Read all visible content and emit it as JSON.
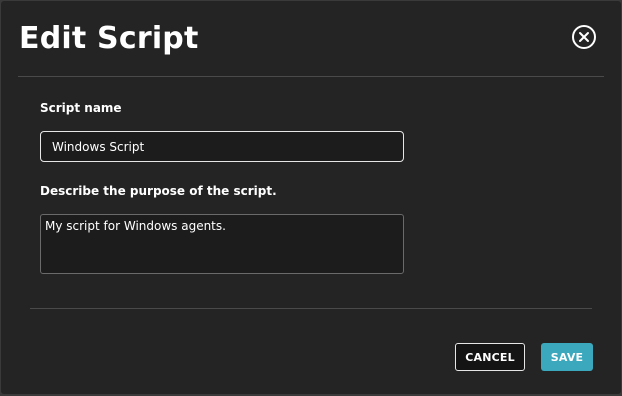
{
  "dialog": {
    "title": "Edit Script",
    "close_icon": "close-circle-icon"
  },
  "form": {
    "name_label": "Script name",
    "name_value": "Windows Script",
    "description_label": "Describe the purpose of the script.",
    "description_value": "My script for Windows agents."
  },
  "actions": {
    "cancel_label": "CANCEL",
    "save_label": "SAVE"
  },
  "colors": {
    "background": "#242424",
    "accent": "#3ba8bd",
    "text": "#ffffff"
  }
}
